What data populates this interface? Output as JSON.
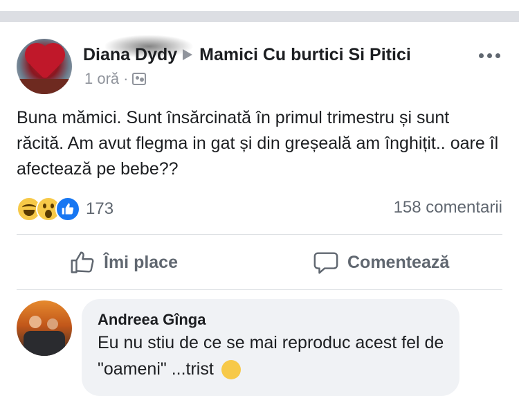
{
  "post": {
    "author": "Diana Dydy",
    "group": "Mamici Cu burtici Si Pitici",
    "time": "1 oră",
    "separator": "·",
    "text": "Buna mămici. Sunt însărcinată în primul trimestru și sunt răcită. Am avut flegma in gat și din greșeală am înghițit.. oare îl afectează pe bebe??",
    "reactions": {
      "types": [
        "haha",
        "wow",
        "like"
      ],
      "count": "173"
    },
    "comments_count": "158 comentarii"
  },
  "actions": {
    "like_label": "Îmi place",
    "comment_label": "Comentează"
  },
  "comment": {
    "author": "Andreea Gînga",
    "text": "Eu nu stiu de ce se mai reproduc acest fel de \"oameni\" ...trist"
  },
  "icons": {
    "more": "more-options-icon",
    "audience": "audience-icon",
    "like": "thumbs-up-icon",
    "comment": "comment-bubble-icon"
  },
  "colors": {
    "like_blue": "#1877f2",
    "secondary_text": "#606770",
    "bubble_bg": "#f0f2f5"
  }
}
